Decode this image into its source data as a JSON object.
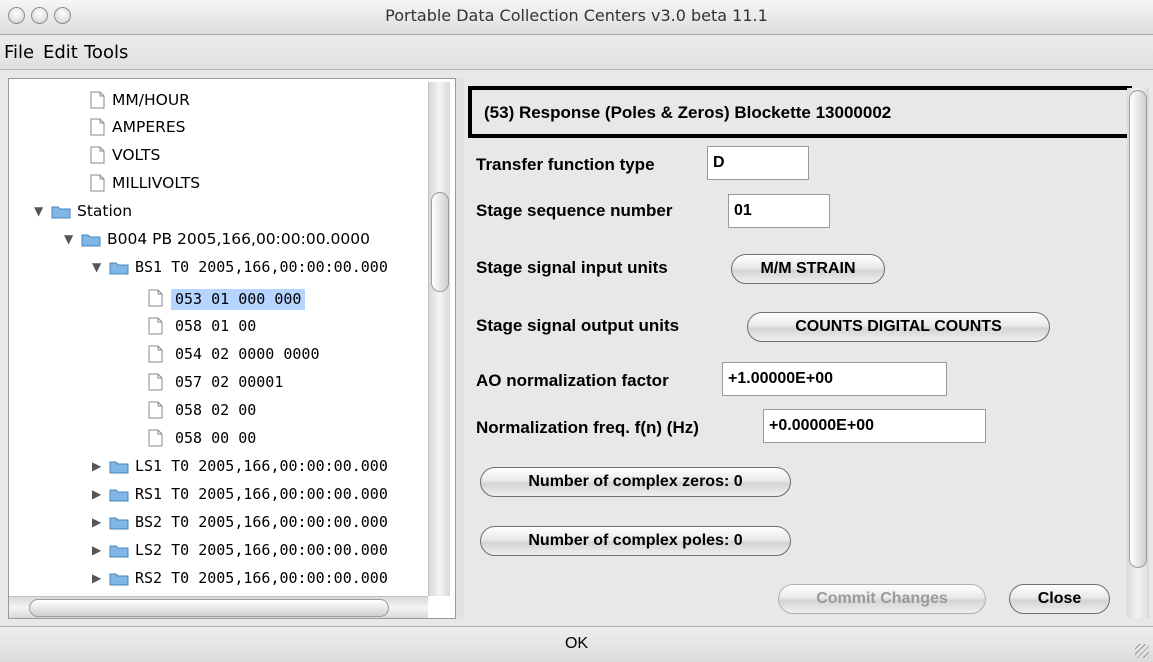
{
  "window": {
    "title": "Portable Data Collection Centers v3.0 beta 11.1"
  },
  "menu": {
    "file": "File",
    "edit": "Edit",
    "tools": "Tools"
  },
  "tree": {
    "units": [
      "MM/HOUR",
      "AMPERES",
      "VOLTS",
      "MILLIVOLTS"
    ],
    "station_label": "Station",
    "b004": "B004 PB 2005,166,00:00:00.0000",
    "bs1": "BS1 T0 2005,166,00:00:00.000",
    "bs1_children": [
      "053 01 000 000",
      "058 01 00",
      "054 02 0000 0000",
      "057 02 00001",
      "058 02 00",
      "058 00 00"
    ],
    "selected_index": 0,
    "siblings": [
      "LS1 T0 2005,166,00:00:00.000",
      "RS1 T0 2005,166,00:00:00.000",
      "BS2 T0 2005,166,00:00:00.000",
      "LS2 T0 2005,166,00:00:00.000",
      "RS2 T0 2005,166,00:00:00.000"
    ]
  },
  "form": {
    "header": "(53) Response (Poles & Zeros) Blockette 13000002",
    "transfer_label": "Transfer function type",
    "transfer_value": "D",
    "stage_seq_label": "Stage sequence number",
    "stage_seq_value": "01",
    "input_units_label": "Stage signal input units",
    "input_units_value": "M/M STRAIN",
    "output_units_label": "Stage signal output units",
    "output_units_value": "COUNTS DIGITAL COUNTS",
    "ao_label": "AO normalization factor",
    "ao_value": "+1.00000E+00",
    "norm_freq_label": "Normalization freq. f(n) (Hz)",
    "norm_freq_value": "+0.00000E+00",
    "zeros_button": "Number of complex zeros: 0",
    "poles_button": "Number of complex poles: 0",
    "commit_button": "Commit Changes",
    "close_button": "Close"
  },
  "status": {
    "text": "OK"
  },
  "colors": {
    "selection": "#b5d4ff",
    "folder": "#7fb8e6"
  }
}
